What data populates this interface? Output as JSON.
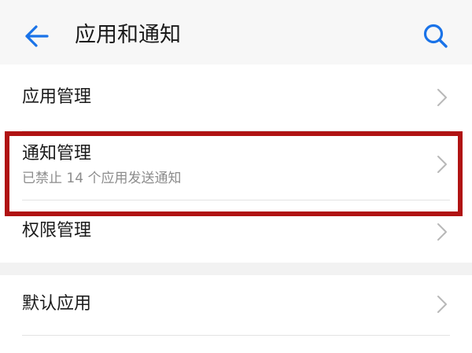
{
  "header": {
    "title": "应用和通知",
    "back_icon": "arrow-left-icon",
    "search_icon": "search-icon"
  },
  "list": {
    "items": [
      {
        "label": "应用管理"
      },
      {
        "label": "通知管理",
        "subtitle": "已禁止 14 个应用发送通知"
      },
      {
        "label": "权限管理"
      },
      {
        "label": "默认应用"
      }
    ]
  },
  "colors": {
    "accent": "#1a73e8",
    "highlight_border": "#b01313",
    "page_background": "#f2f2f2",
    "card_background": "#ffffff"
  }
}
